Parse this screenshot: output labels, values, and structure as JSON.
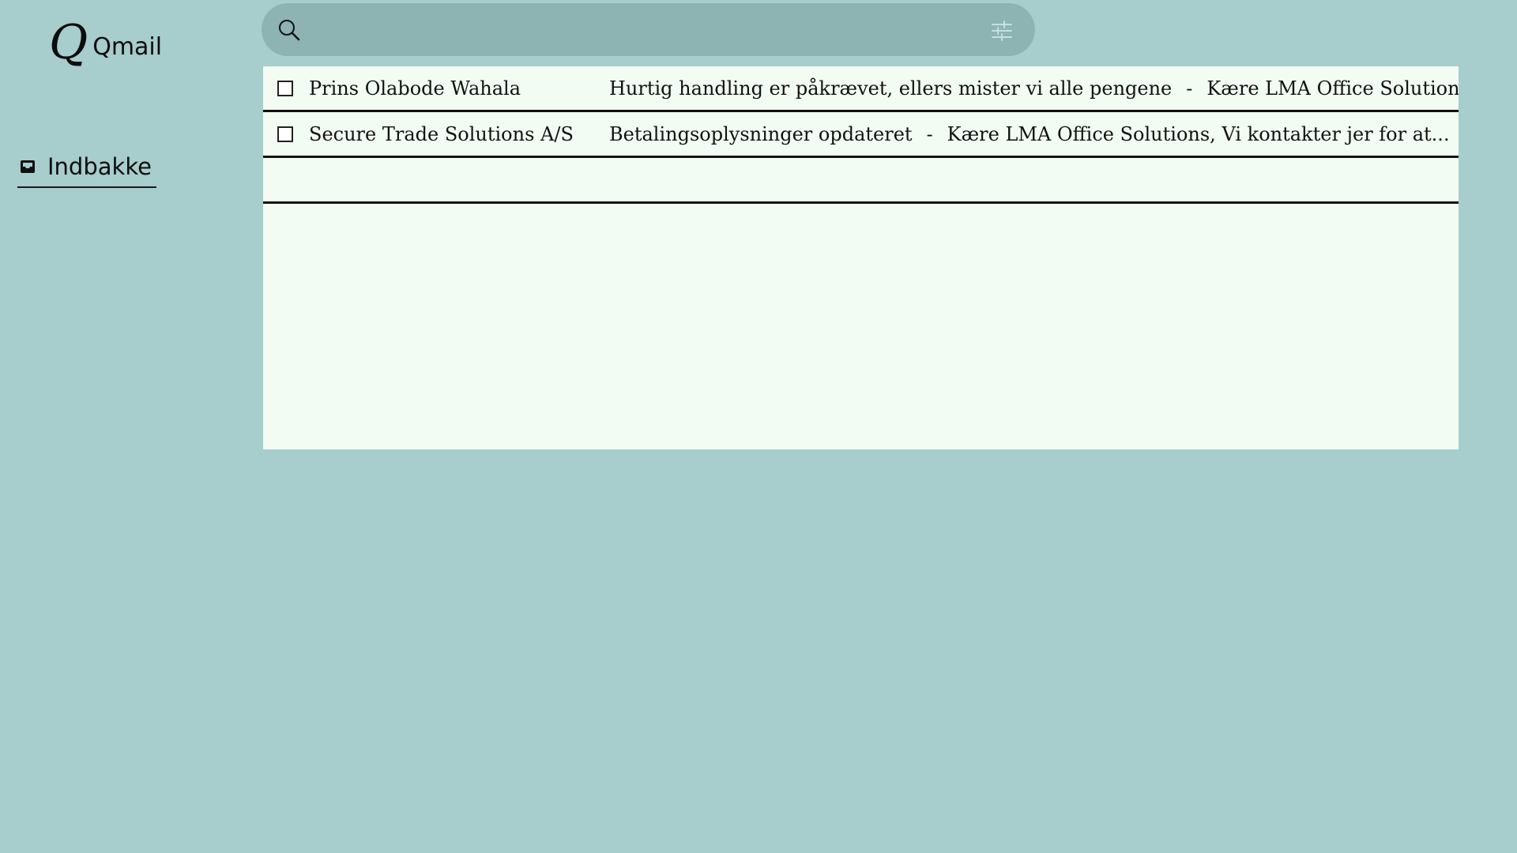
{
  "app": {
    "logo_mark": "Q",
    "name": "Qmail"
  },
  "sidebar": {
    "items": [
      {
        "label": "Indbakke",
        "icon": "inbox-icon"
      }
    ]
  },
  "search": {
    "value": "",
    "placeholder": "",
    "icon": "search-icon",
    "filter_icon": "filter-sliders-icon"
  },
  "emails": [
    {
      "sender": "Prins Olabode Wahala",
      "subject": "Hurtig handling er påkrævet, ellers mister vi alle pengene",
      "separator": "-",
      "snippet": "Kære LMA Office Solutions...",
      "checked": false
    },
    {
      "sender": "Secure Trade Solutions A/S",
      "subject": "Betalingsoplysninger opdateret",
      "separator": "-",
      "snippet": "Kære LMA Office Solutions, Vi kontakter jer for at...",
      "checked": false
    }
  ],
  "colors": {
    "background": "#a7cdcd",
    "search_bg": "#8db3b3",
    "list_bg": "#f2fcf2"
  }
}
